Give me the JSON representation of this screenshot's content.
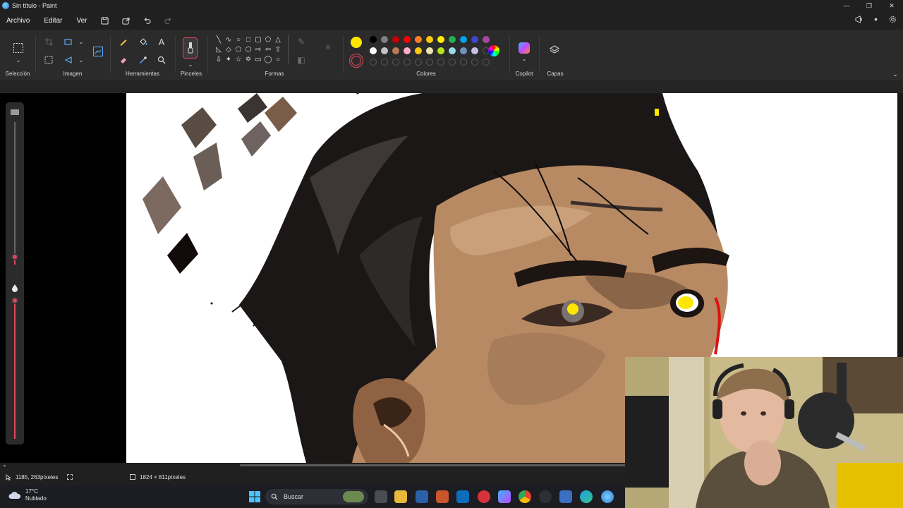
{
  "window": {
    "title": "Sin título - Paint",
    "controls": [
      "—",
      "❐",
      "✕"
    ]
  },
  "menu": {
    "items": [
      "Archivo",
      "Editar",
      "Ver"
    ]
  },
  "ribbon": {
    "groups": {
      "seleccion": "Selección",
      "imagen": "Imagen",
      "herramientas": "Herramientas",
      "pinceles": "Pinceles",
      "formas": "Formas",
      "colores": "Colores",
      "copilot": "Copilot",
      "capas": "Capas"
    },
    "primary_color": "#ffe600",
    "palette": [
      "#000000",
      "#7f7f7f",
      "#c00000",
      "#ff0000",
      "#ff7f27",
      "#ffc90e",
      "#ffef00",
      "#22b14c",
      "#00a2e8",
      "#3f48cc",
      "#a349a4",
      "#ffffff",
      "#c3c3c3",
      "#b97a57",
      "#ffaec9",
      "#ffc90e",
      "#efe4b0",
      "#b5e61d",
      "#99d9ea",
      "#7092be",
      "#c8bfe7"
    ]
  },
  "status": {
    "cursor_position": "1185, 263píxeles",
    "canvas_size": "1824 × 811píxeles"
  },
  "taskbar": {
    "temperature": "17°C",
    "condition": "Nublado",
    "search_placeholder": "Buscar"
  }
}
